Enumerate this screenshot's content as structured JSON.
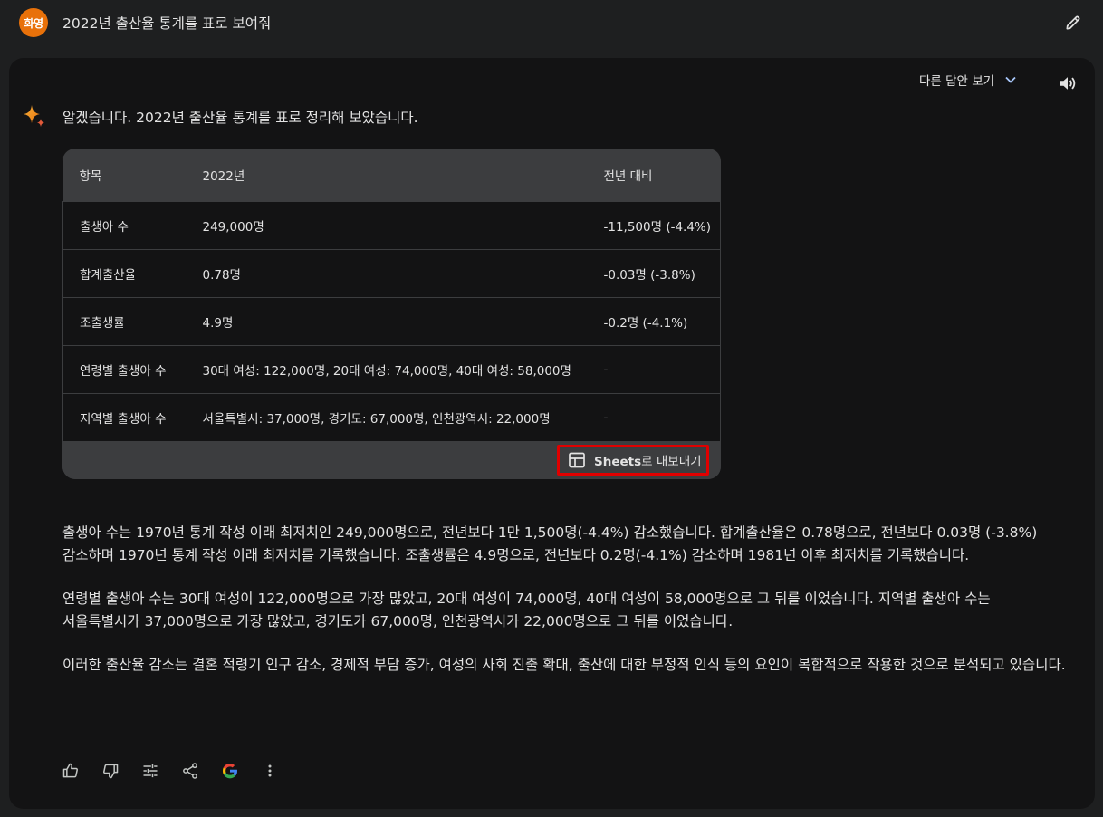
{
  "query": {
    "avatar_text": "화영",
    "text": "2022년 출산율 통계를 표로 보여줘"
  },
  "response": {
    "alt_drafts_label": "다른 답안 보기",
    "intro": "알겠습니다. 2022년 출산율 통계를 표로 정리해 보았습니다.",
    "table": {
      "headers": [
        "항목",
        "2022년",
        "전년 대비"
      ],
      "rows": [
        [
          "출생아 수",
          "249,000명",
          "-11,500명 (-4.4%)"
        ],
        [
          "합계출산율",
          "0.78명",
          "-0.03명 (-3.8%)"
        ],
        [
          "조출생률",
          "4.9명",
          "-0.2명 (-4.1%)"
        ],
        [
          "연령별 출생아 수",
          "30대 여성: 122,000명, 20대 여성: 74,000명, 40대 여성: 58,000명",
          "-"
        ],
        [
          "지역별 출생아 수",
          "서울특별시: 37,000명, 경기도: 67,000명, 인천광역시: 22,000명",
          "-"
        ]
      ],
      "export_label_bold": "Sheets",
      "export_label_rest": "로 내보내기"
    },
    "paragraphs": [
      "출생아 수는 1970년 통계 작성 이래 최저치인 249,000명으로, 전년보다 1만 1,500명(-4.4%) 감소했습니다. 합계출산율은 0.78명으로, 전년보다 0.03명 (-3.8%) 감소하며 1970년 통계 작성 이래 최저치를 기록했습니다. 조출생률은 4.9명으로, 전년보다 0.2명(-4.1%) 감소하며 1981년 이후 최저치를 기록했습니다.",
      "연령별 출생아 수는 30대 여성이 122,000명으로 가장 많았고, 20대 여성이 74,000명, 40대 여성이 58,000명으로 그 뒤를 이었습니다. 지역별 출생아 수는 서울특별시가 37,000명으로 가장 많았고, 경기도가 67,000명, 인천광역시가 22,000명으로 그 뒤를 이었습니다.",
      "이러한 출산율 감소는 결혼 적령기 인구 감소, 경제적 부담 증가, 여성의 사회 진출 확대, 출산에 대한 부정적 인식 등의 요인이 복합적으로 작용한 것으로 분석되고 있습니다."
    ]
  },
  "icons": {
    "edit": "pencil-icon",
    "drafts": "chevron-down-icon",
    "speaker": "speaker-icon",
    "assistant": "sparkle-icon",
    "export": "table-icon",
    "actions": [
      "thumbs-up-icon",
      "thumbs-down-icon",
      "tune-icon",
      "share-icon",
      "google-icon",
      "more-vert-icon"
    ]
  },
  "colors": {
    "avatar": "#e8710a",
    "highlight_border": "#e00000",
    "card_bg": "#131314",
    "page_bg": "#1e1f20"
  }
}
